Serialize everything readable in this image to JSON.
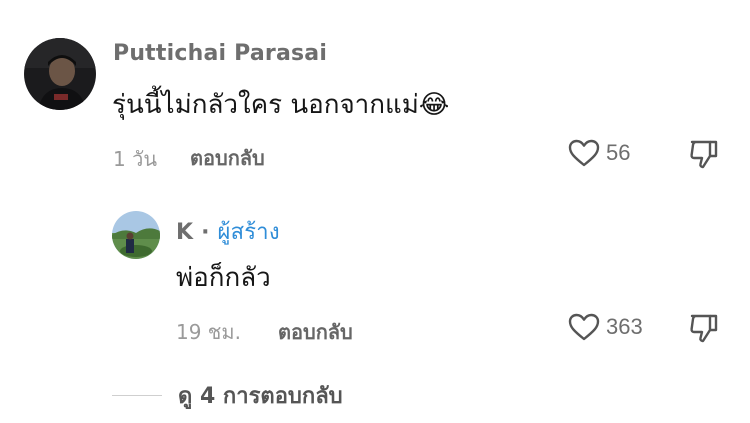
{
  "comments": [
    {
      "username": "Puttichai Parasai",
      "text": "รุ่นนี้ไม่กลัวใคร นอกจากแม่",
      "emoji": "😂",
      "time": "1 วัน",
      "reply_label": "ตอบกลับ",
      "likes": "56"
    },
    {
      "username": "K",
      "separator": "·",
      "creator_tag": "ผู้สร้าง",
      "text": "พ่อก็กลัว",
      "time": "19 ชม.",
      "reply_label": "ตอบกลับ",
      "likes": "363"
    }
  ],
  "view_replies_label": "ดู 4 การตอบกลับ",
  "icons": {
    "like": "heart-outline-icon",
    "dislike": "thumbs-down-icon"
  },
  "colors": {
    "creator_accent": "#2f8dd8",
    "text": "#161616",
    "muted": "#9a9a9a"
  }
}
